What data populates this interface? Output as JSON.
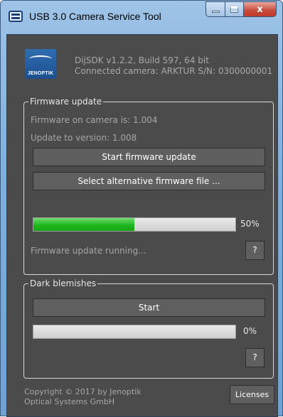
{
  "window": {
    "title": "USB 3.0 Camera Service Tool",
    "close_glyph": "x"
  },
  "header": {
    "logo_text": "JENOPTIK",
    "sdk_line": "DijSDK v1.2.2, Build 597, 64 bit",
    "camera_line": "Connected camera: ARKTUR S/N: 0300000001"
  },
  "firmware": {
    "legend": "Firmware update",
    "on_camera": "Firmware on camera is: 1.004",
    "update_to": "Update to version: 1.008",
    "start_button": "Start firmware update",
    "select_button": "Select alternative firmware file ...",
    "progress_value": 0.5,
    "progress_label": "50%",
    "status": "Firmware update running...",
    "help_button": "?"
  },
  "dark_blemishes": {
    "legend": "Dark blemishes",
    "start_button": "Start",
    "progress_value": 0,
    "progress_label": "0%",
    "help_button": "?"
  },
  "footer": {
    "copyright_line1": "Copyright © 2017 by Jenoptik",
    "copyright_line2": "Optical Systems GmbH",
    "licenses_button": "Licenses"
  },
  "colors": {
    "background": "#4b4b4b",
    "button": "#5f5f5f",
    "progress_fill": "#1fb81f"
  }
}
